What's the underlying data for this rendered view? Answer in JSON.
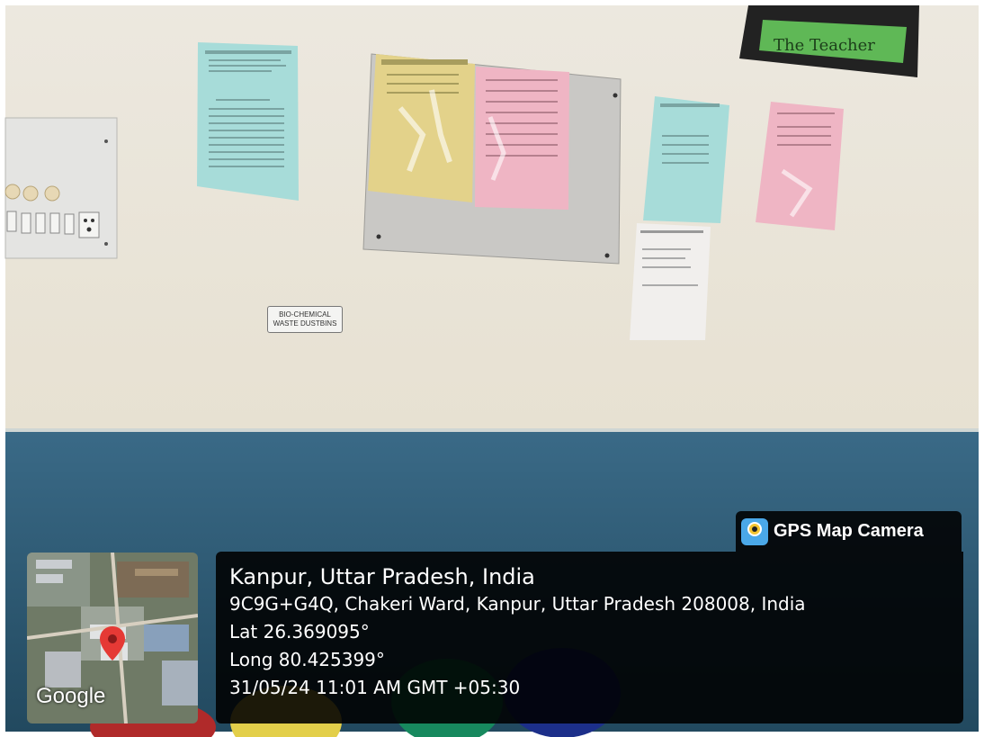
{
  "poster_texts": {
    "sign_line1": "BIO-CHEMICAL",
    "sign_line2": "WASTE DUSTBINS",
    "frame_text": "The Teacher"
  },
  "overlay": {
    "app_name": "GPS Map Camera",
    "app_icon": "gps-map-camera-icon",
    "map_brand": "Google",
    "location_title": "Kanpur, Uttar Pradesh, India",
    "address": "9C9G+G4Q, Chakeri Ward, Kanpur, Uttar Pradesh 208008, India",
    "latitude": "Lat 26.369095°",
    "longitude": "Long 80.425399°",
    "timestamp": "31/05/24 11:01 AM GMT +05:30"
  },
  "colors": {
    "wall": "#ece8df",
    "wall_band": "#2c5a78",
    "poster_blue": "#a7dcd9",
    "poster_yellow": "#e3d28a",
    "poster_pink": "#efb5c4",
    "overlay_bg": "#111111",
    "map_pin": "#e53935"
  }
}
